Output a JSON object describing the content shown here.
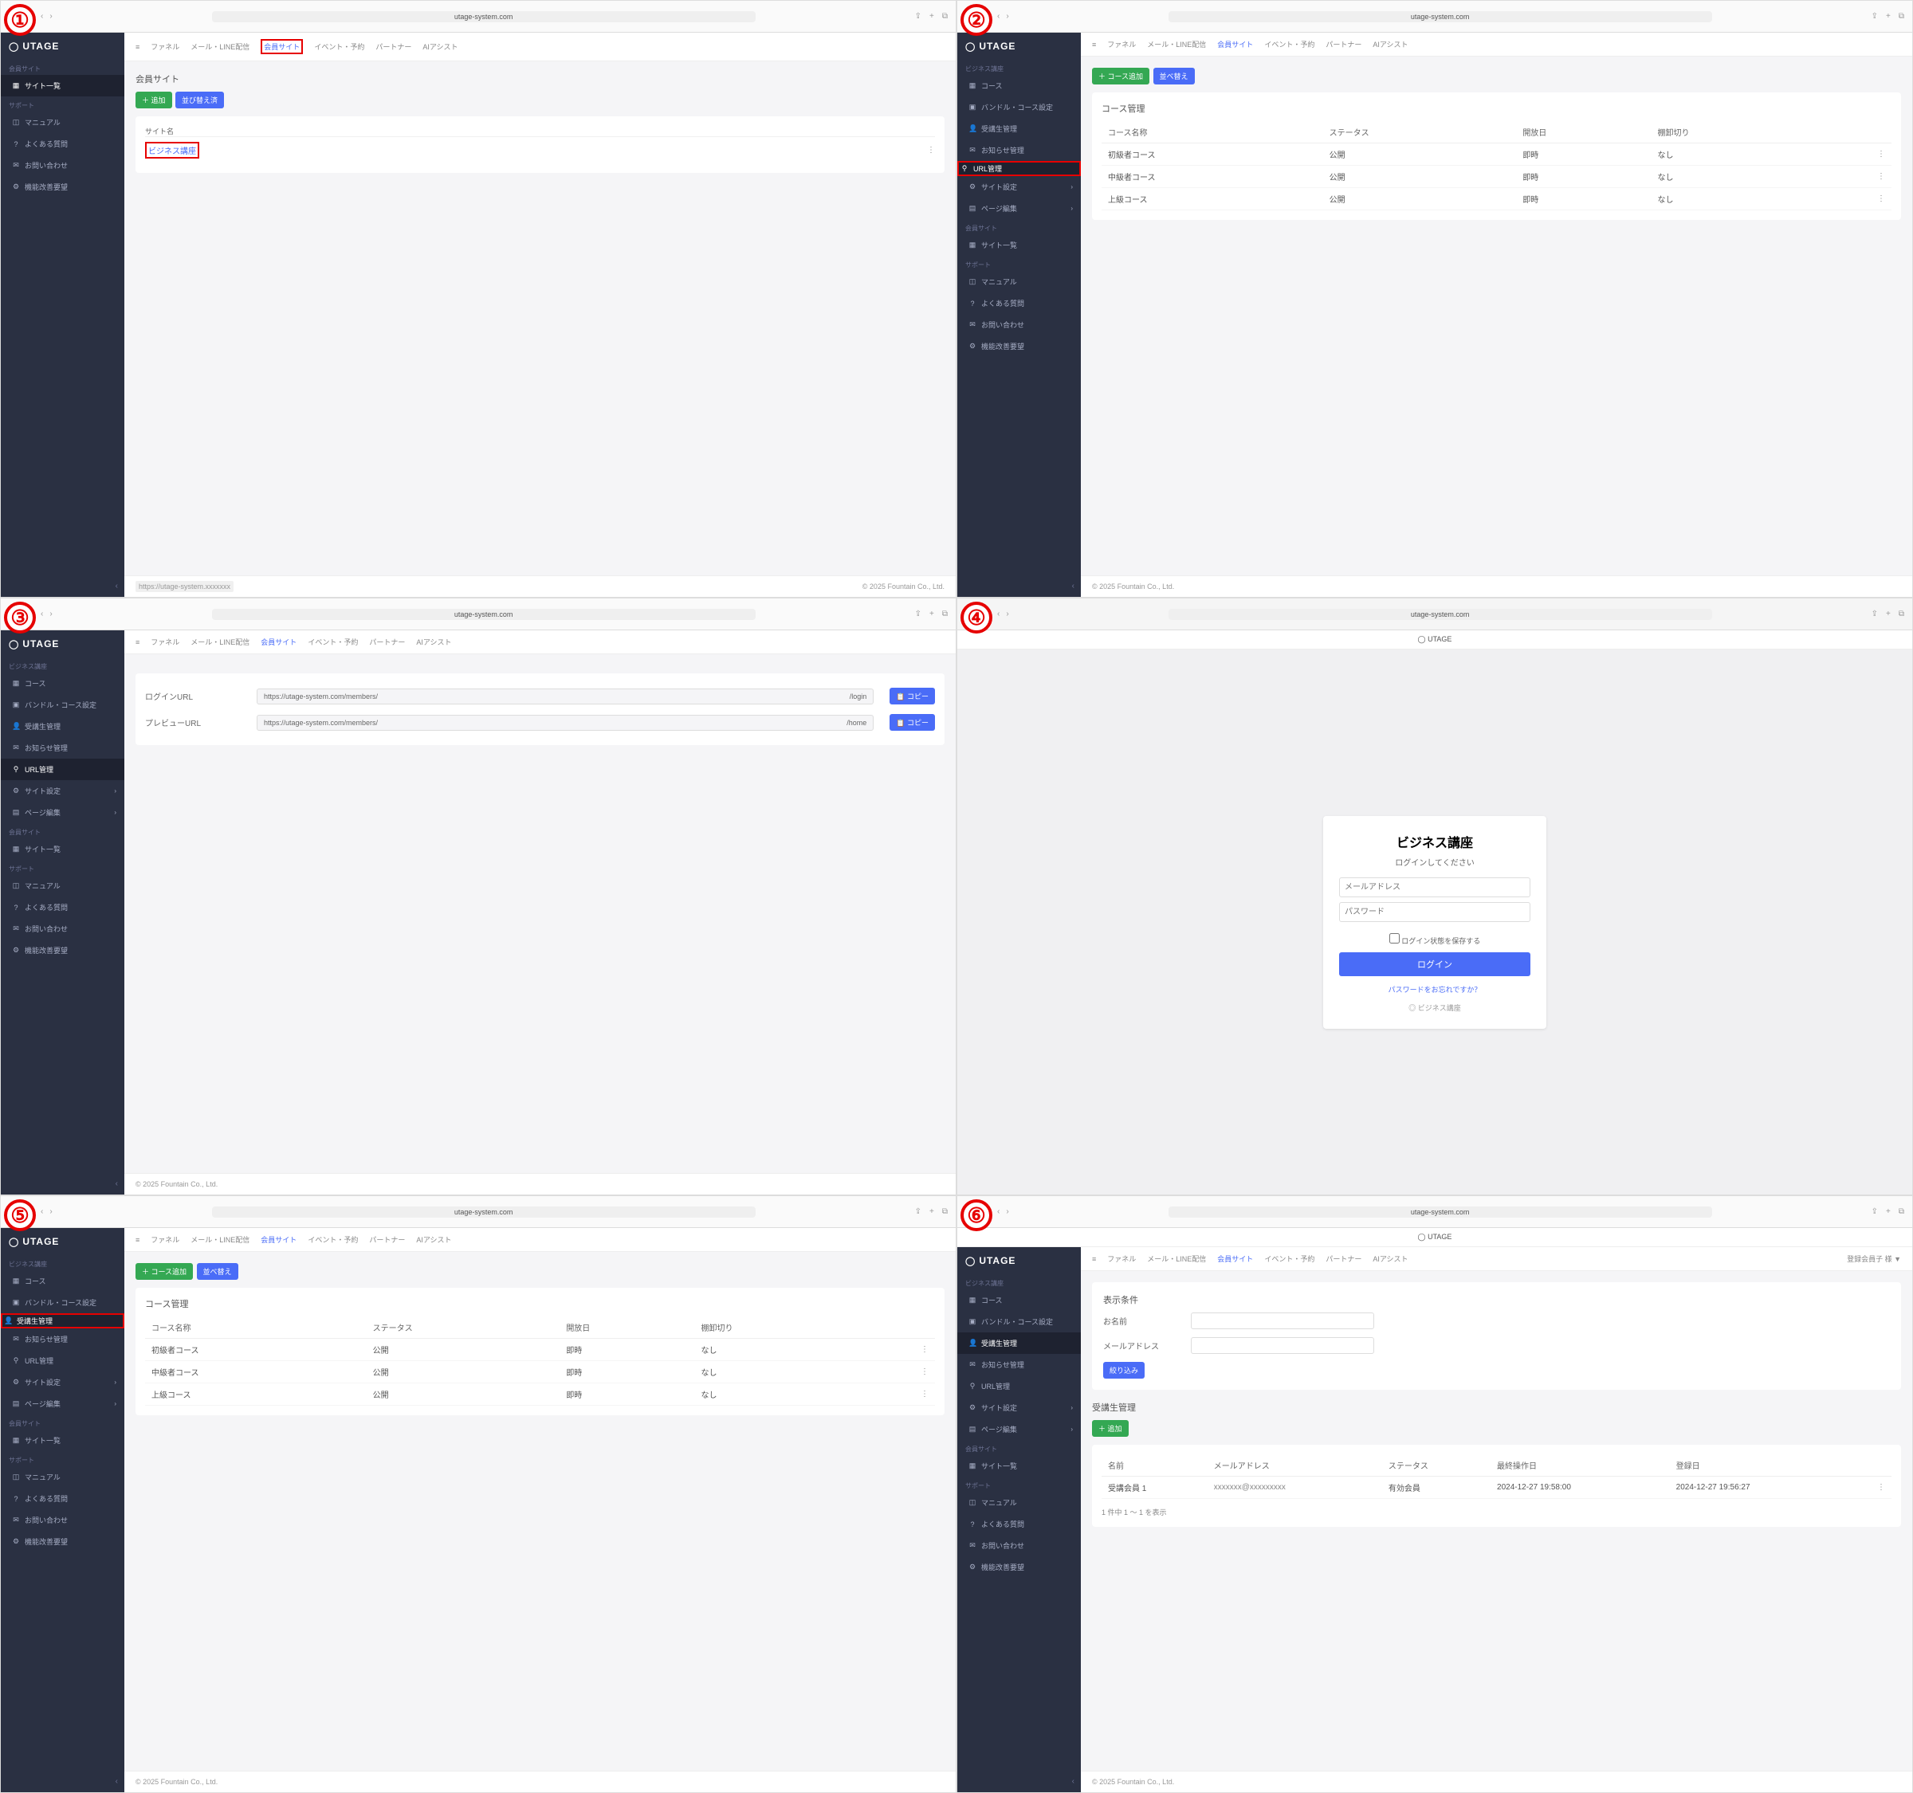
{
  "browser": {
    "url": "utage-system.com"
  },
  "logo": "UTAGE",
  "footer": "© 2025 Fountain Co., Ltd.",
  "topnav": {
    "hamburger": "≡",
    "items": [
      "ファネル",
      "メール・LINE配信",
      "会員サイト",
      "イベント・予約",
      "パートナー",
      "AIアシスト"
    ]
  },
  "panel1": {
    "sidebar": {
      "section1": "会員サイト",
      "items1": [
        {
          "ico": "▦",
          "label": "サイト一覧"
        }
      ],
      "section2": "サポート",
      "items2": [
        {
          "ico": "◫",
          "label": "マニュアル"
        },
        {
          "ico": "?",
          "label": "よくある質問"
        },
        {
          "ico": "✉",
          "label": "お問い合わせ"
        },
        {
          "ico": "⚙",
          "label": "機能改善要望"
        }
      ]
    },
    "cardTitle": "会員サイト",
    "btnAdd": "＋ 追加",
    "btnSort": "並び替え済",
    "colSite": "サイト名",
    "site": "ビジネス講座",
    "statusHover": "https://utage-system.xxxxxxx"
  },
  "panel2": {
    "sidebar": {
      "section1": "ビジネス講座",
      "items1": [
        {
          "ico": "▦",
          "label": "コース"
        },
        {
          "ico": "▣",
          "label": "バンドル・コース設定"
        },
        {
          "ico": "👤",
          "label": "受講生管理"
        },
        {
          "ico": "✉",
          "label": "お知らせ管理"
        },
        {
          "ico": "⚲",
          "label": "URL管理"
        },
        {
          "ico": "⚙",
          "label": "サイト設定",
          "chev": "›"
        },
        {
          "ico": "▤",
          "label": "ページ編集",
          "chev": "›"
        }
      ],
      "section2": "会員サイト",
      "items2": [
        {
          "ico": "▦",
          "label": "サイト一覧"
        }
      ],
      "section3": "サポート",
      "items3": [
        {
          "ico": "◫",
          "label": "マニュアル"
        },
        {
          "ico": "?",
          "label": "よくある質問"
        },
        {
          "ico": "✉",
          "label": "お問い合わせ"
        },
        {
          "ico": "⚙",
          "label": "機能改善要望"
        }
      ]
    },
    "btnAdd": "＋ コース追加",
    "btnSort": "並べ替え",
    "cardTitle": "コース管理",
    "cols": [
      "コース名称",
      "ステータス",
      "開放日",
      "棚卸切り"
    ],
    "rows": [
      [
        "初級者コース",
        "公開",
        "即時",
        "なし"
      ],
      [
        "中級者コース",
        "公開",
        "即時",
        "なし"
      ],
      [
        "上級コース",
        "公開",
        "即時",
        "なし"
      ]
    ]
  },
  "panel3": {
    "labels": {
      "login": "ログインURL",
      "preview": "プレビューURL"
    },
    "loginUrl": {
      "base": "https://utage-system.com/members/",
      "suffix": "/login"
    },
    "previewUrl": {
      "base": "https://utage-system.com/members/",
      "suffix": "/home"
    },
    "copyBtn": "📋 コピー"
  },
  "panel4": {
    "miniLogo": "◯ UTAGE",
    "title": "ビジネス講座",
    "subtitle": "ログインしてください",
    "ph_email": "メールアドレス",
    "ph_password": "パスワード",
    "check": "ログイン状態を保存する",
    "loginBtn": "ログイン",
    "forgot": "パスワードをお忘れですか？",
    "footBrand": "◎ ビジネス講座"
  },
  "panel5": {
    "btnAdd": "＋ コース追加",
    "btnSort": "並べ替え",
    "cardTitle": "コース管理",
    "cols": [
      "コース名称",
      "ステータス",
      "開放日",
      "棚卸切り"
    ],
    "rows": [
      [
        "初級者コース",
        "公開",
        "即時",
        "なし"
      ],
      [
        "中級者コース",
        "公開",
        "即時",
        "なし"
      ],
      [
        "上級コース",
        "公開",
        "即時",
        "なし"
      ]
    ]
  },
  "panel6": {
    "userRight": "登録会員子 様 ▼",
    "searchTitle": "表示条件",
    "lblName": "お名前",
    "lblEmail": "メールアドレス",
    "btnSearch": "絞り込み",
    "listTitle": "受講生管理",
    "btnAdd": "＋ 追加",
    "cols": [
      "名前",
      "メールアドレス",
      "ステータス",
      "最終操作日",
      "登録日"
    ],
    "row": [
      "受講会員 1",
      "xxxxxxx@xxxxxxxxx",
      "有効会員",
      "2024-12-27 19:58:00",
      "2024-12-27 19:56:27"
    ],
    "pager": "1 件中 1 ～ 1 を表示"
  }
}
